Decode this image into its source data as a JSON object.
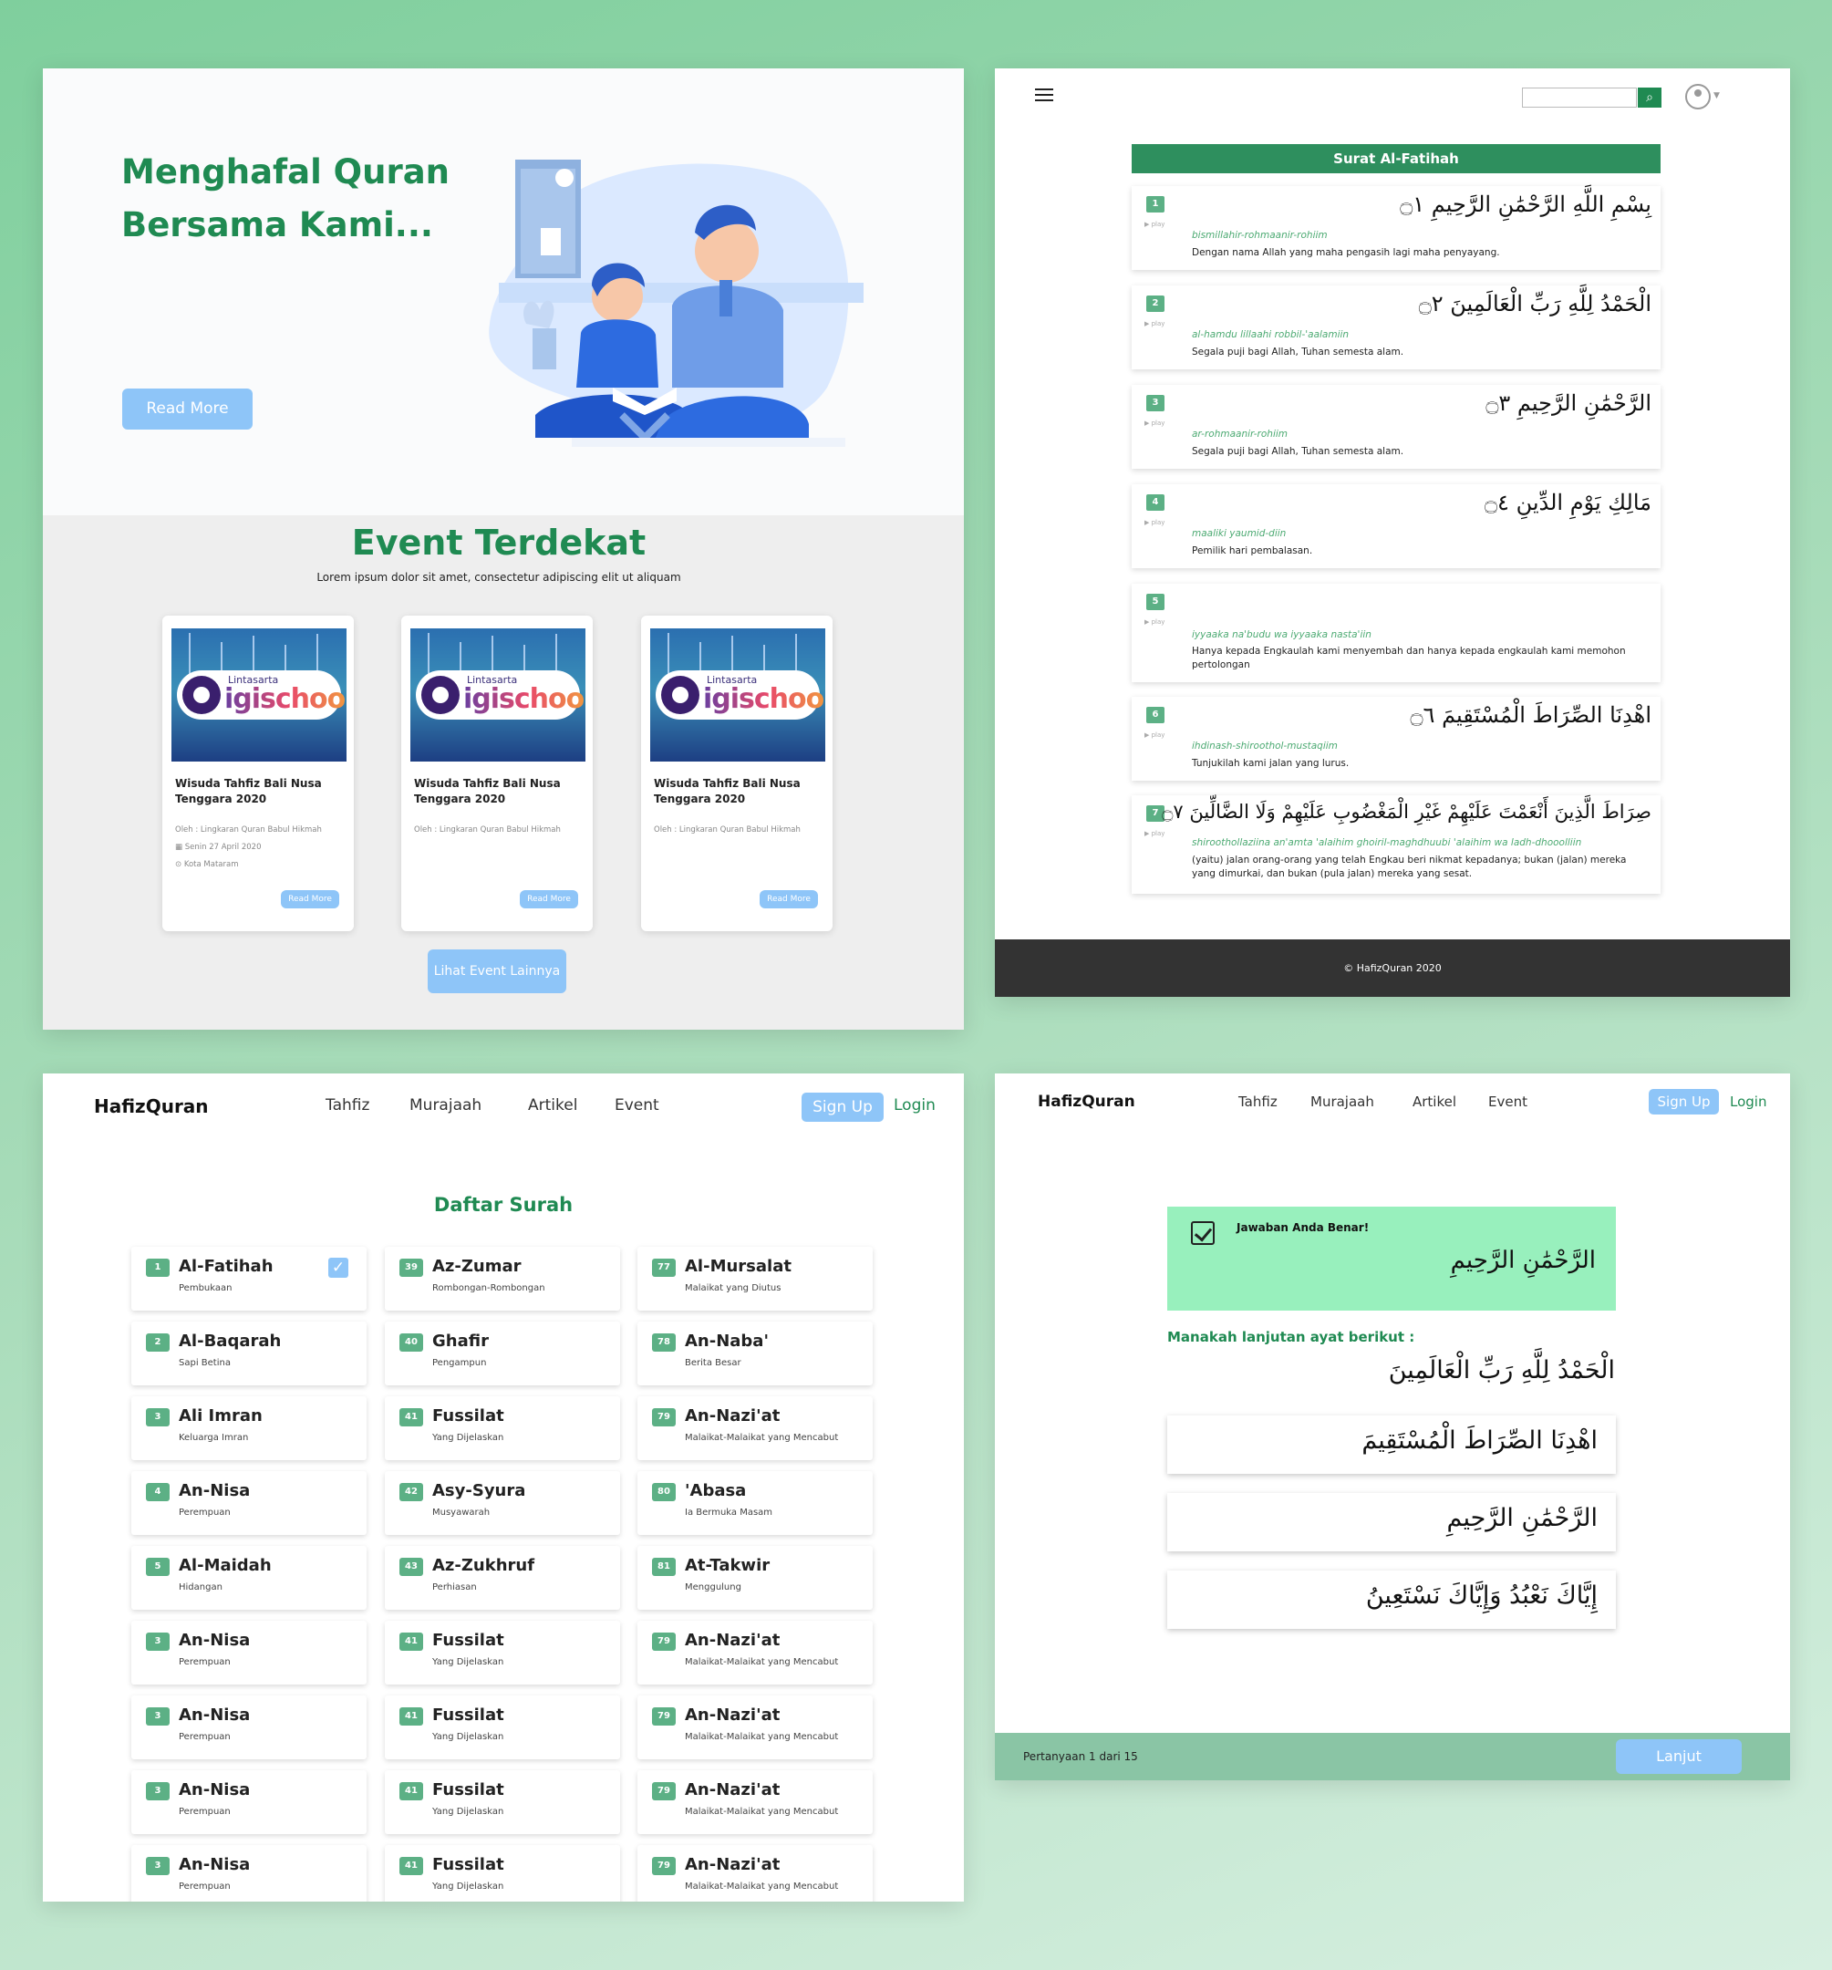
{
  "home": {
    "hero_title": "Menghafal Quran Bersama Kami...",
    "read_more": "Read More",
    "events_title": "Event Terdekat",
    "events_subtitle": "Lorem ipsum dolor sit amet, consectetur adipiscing elit ut aliquam",
    "logo_small": "Lintasarta",
    "logo_big": "igischool",
    "events": [
      {
        "name": "Wisuda Tahfiz Bali Nusa Tenggara 2020",
        "by": "Oleh : Lingkaran Quran Babul Hikmah",
        "date": "Senin 27 April 2020",
        "place": "Kota Mataram",
        "button": "Read More"
      },
      {
        "name": "Wisuda Tahfiz Bali Nusa Tenggara 2020",
        "by": "Oleh : Lingkaran Quran Babul Hikmah",
        "button": "Read More"
      },
      {
        "name": "Wisuda Tahfiz Bali Nusa Tenggara 2020",
        "by": "Oleh : Lingkaran Quran Babul Hikmah",
        "button": "Read More"
      }
    ],
    "more_events": "Lihat Event Lainnya"
  },
  "reader": {
    "surah_title": "Surat Al-Fatihah",
    "play_label": "▶ play",
    "footer": "© HafizQuran 2020",
    "ayat": [
      {
        "no": "1",
        "arabic": "بِسْمِ اللَّهِ الرَّحْمَٰنِ الرَّحِيمِ ۝١",
        "latin": "bismillahir-rohmaanir-rohiim",
        "meaning": "Dengan nama Allah yang maha pengasih lagi maha penyayang."
      },
      {
        "no": "2",
        "arabic": "الْحَمْدُ لِلَّهِ رَبِّ الْعَالَمِينَ ۝٢",
        "latin": "al-hamdu lillaahi robbil-'aalamiin",
        "meaning": "Segala puji bagi Allah, Tuhan semesta alam."
      },
      {
        "no": "3",
        "arabic": "الرَّحْمَٰنِ الرَّحِيمِ ۝٣",
        "latin": "ar-rohmaanir-rohiim",
        "meaning": "Segala puji bagi Allah, Tuhan semesta alam."
      },
      {
        "no": "4",
        "arabic": "مَالِكِ يَوْمِ الدِّينِ ۝٤",
        "latin": "maaliki yaumid-diin",
        "meaning": "Pemilik hari pembalasan."
      },
      {
        "no": "5",
        "arabic": "",
        "latin": "iyyaaka na'budu wa iyyaaka nasta'iin",
        "meaning": "Hanya kepada Engkaulah kami menyembah dan hanya kepada engkaulah kami memohon pertolongan"
      },
      {
        "no": "6",
        "arabic": "اهْدِنَا الصِّرَاطَ الْمُسْتَقِيمَ ۝٦",
        "latin": "ihdinash-shiroothol-mustaqiim",
        "meaning": "Tunjukilah kami jalan yang lurus."
      },
      {
        "no": "7",
        "arabic": "صِرَاطَ الَّذِينَ أَنْعَمْتَ عَلَيْهِمْ غَيْرِ الْمَغْضُوبِ عَلَيْهِمْ وَلَا الضَّالِّينَ ۝٧",
        "latin": "shiroothollaziina an'amta 'alaihim ghoiril-maghdhuubi 'alaihim wa ladh-dhooolliin",
        "meaning": "(yaitu) jalan orang-orang yang telah Engkau  beri nikmat kepadanya; bukan (jalan) mereka yang dimurkai, dan bukan (pula jalan) mereka yang sesat."
      }
    ]
  },
  "nav": {
    "brand": "HafizQuran",
    "links": [
      "Tahfiz",
      "Murajaah",
      "Artikel",
      "Event"
    ],
    "signup": "Sign Up",
    "login": "Login"
  },
  "surah_list": {
    "title": "Daftar Surah",
    "columns": [
      [
        {
          "no": "1",
          "name": "Al-Fatihah",
          "meaning": "Pembukaan",
          "checked": true
        },
        {
          "no": "2",
          "name": "Al-Baqarah",
          "meaning": "Sapi Betina"
        },
        {
          "no": "3",
          "name": "Ali Imran",
          "meaning": "Keluarga Imran"
        },
        {
          "no": "4",
          "name": "An-Nisa",
          "meaning": "Perempuan"
        },
        {
          "no": "5",
          "name": "Al-Maidah",
          "meaning": "Hidangan"
        },
        {
          "no": "3",
          "name": "An-Nisa",
          "meaning": "Perempuan"
        },
        {
          "no": "3",
          "name": "An-Nisa",
          "meaning": "Perempuan"
        },
        {
          "no": "3",
          "name": "An-Nisa",
          "meaning": "Perempuan"
        },
        {
          "no": "3",
          "name": "An-Nisa",
          "meaning": "Perempuan"
        }
      ],
      [
        {
          "no": "39",
          "name": "Az-Zumar",
          "meaning": "Rombongan-Rombongan"
        },
        {
          "no": "40",
          "name": "Ghafir",
          "meaning": "Pengampun"
        },
        {
          "no": "41",
          "name": "Fussilat",
          "meaning": "Yang Dijelaskan"
        },
        {
          "no": "42",
          "name": "Asy-Syura",
          "meaning": "Musyawarah"
        },
        {
          "no": "43",
          "name": "Az-Zukhruf",
          "meaning": "Perhiasan"
        },
        {
          "no": "41",
          "name": "Fussilat",
          "meaning": "Yang Dijelaskan"
        },
        {
          "no": "41",
          "name": "Fussilat",
          "meaning": "Yang Dijelaskan"
        },
        {
          "no": "41",
          "name": "Fussilat",
          "meaning": "Yang Dijelaskan"
        },
        {
          "no": "41",
          "name": "Fussilat",
          "meaning": "Yang Dijelaskan"
        }
      ],
      [
        {
          "no": "77",
          "name": "Al-Mursalat",
          "meaning": "Malaikat yang Diutus"
        },
        {
          "no": "78",
          "name": "An-Naba'",
          "meaning": "Berita Besar"
        },
        {
          "no": "79",
          "name": "An-Nazi'at",
          "meaning": "Malaikat-Malaikat yang Mencabut"
        },
        {
          "no": "80",
          "name": "'Abasa",
          "meaning": "Ia Bermuka Masam"
        },
        {
          "no": "81",
          "name": "At-Takwir",
          "meaning": "Menggulung"
        },
        {
          "no": "79",
          "name": "An-Nazi'at",
          "meaning": "Malaikat-Malaikat yang Mencabut"
        },
        {
          "no": "79",
          "name": "An-Nazi'at",
          "meaning": "Malaikat-Malaikat yang Mencabut"
        },
        {
          "no": "79",
          "name": "An-Nazi'at",
          "meaning": "Malaikat-Malaikat yang Mencabut"
        },
        {
          "no": "79",
          "name": "An-Nazi'at",
          "meaning": "Malaikat-Malaikat yang Mencabut"
        }
      ]
    ]
  },
  "quiz": {
    "correct_label": "Jawaban Anda Benar!",
    "correct_arabic": "الرَّحْمَٰنِ الرَّحِيمِ",
    "question": "Manakah lanjutan ayat berikut :",
    "question_arabic": "الْحَمْدُ لِلَّهِ رَبِّ الْعَالَمِينَ",
    "options": [
      "اهْدِنَا الصِّرَاطَ الْمُسْتَقِيمَ",
      "الرَّحْمَٰنِ الرَّحِيمِ",
      "إِيَّاكَ نَعْبُدُ وَإِيَّاكَ نَسْتَعِينُ"
    ],
    "progress": "Pertanyaan 1 dari 15",
    "next": "Lanjut"
  },
  "colors": {
    "accent_green": "#1f8a52",
    "button_blue": "#8ec5f8",
    "correct_bg": "#98f0bd"
  }
}
